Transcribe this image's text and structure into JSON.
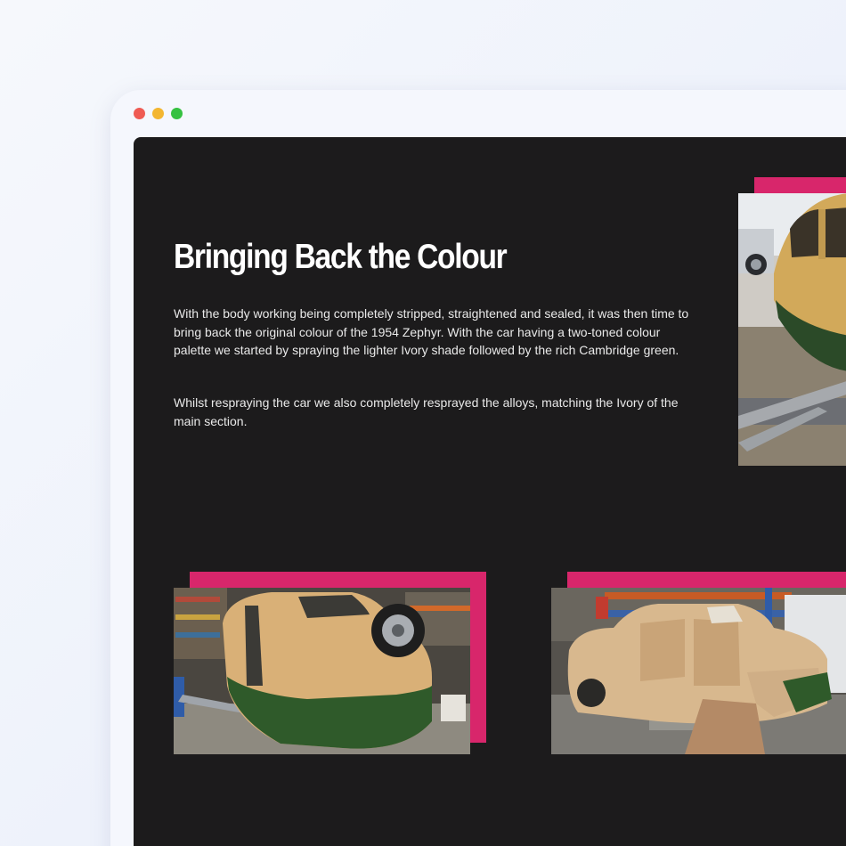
{
  "browser": {
    "window_controls": [
      "close",
      "minimize",
      "maximize"
    ]
  },
  "section": {
    "heading": "Bringing Back the Colour",
    "paragraphs": [
      "With the body working being completely stripped, straightened and sealed, it was then time to bring back the original colour of the 1954 Zephyr. With the car having a two-toned colour palette we started by spraying the lighter Ivory shade followed by the rich Cambridge green.",
      "Whilst respraying the car we also completely resprayed the alloys, matching the Ivory of the main section."
    ]
  },
  "colors": {
    "page_background": "#1c1b1c",
    "accent": "#d8266b",
    "text": "#ffffff",
    "ivory": "#d9b890",
    "cambridge_green": "#2f5a2a"
  }
}
